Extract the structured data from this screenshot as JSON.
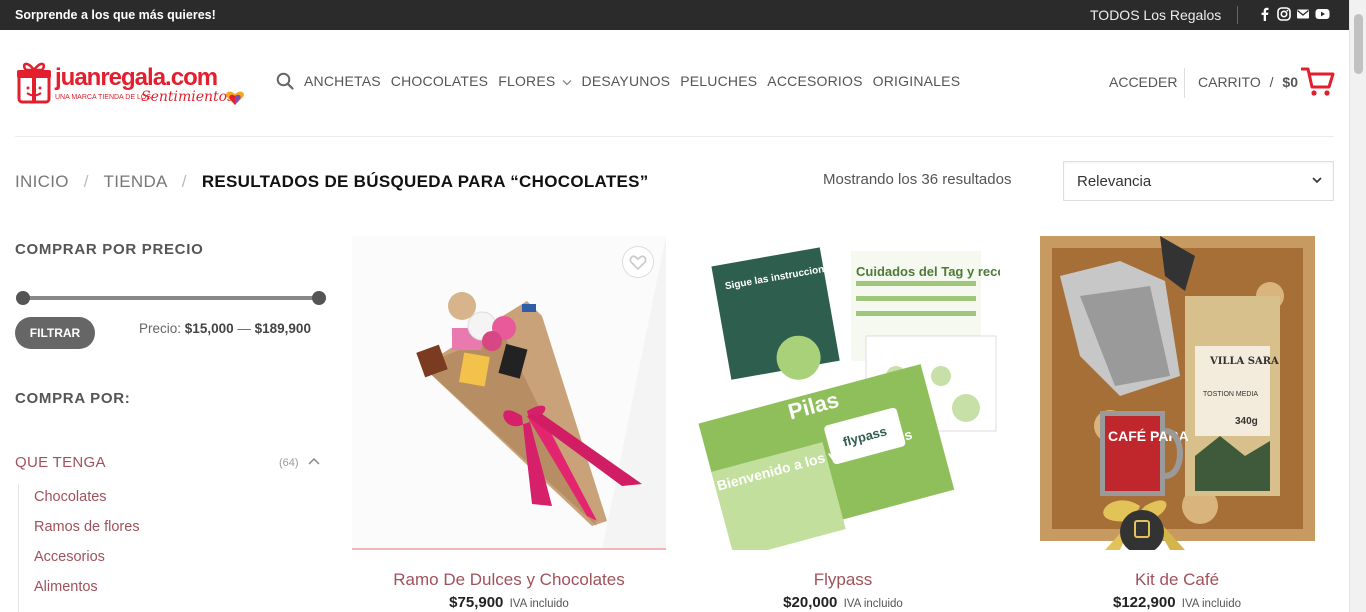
{
  "topbar": {
    "promo": "Sorprende a los que más quieres!",
    "todos": "TODOS Los Regalos",
    "social": [
      "facebook-icon",
      "instagram-icon",
      "email-icon",
      "youtube-icon"
    ]
  },
  "brand": {
    "logo_text": "juanregala.com",
    "tagline": "UNA MARCA TIENDA DE LOS",
    "tagline_script": "Sentimientos",
    "accent": "#e31f2d"
  },
  "nav": {
    "items": [
      "ANCHETAS",
      "CHOCOLATES",
      "FLORES",
      "DESAYUNOS",
      "PELUCHES",
      "ACCESORIOS",
      "ORIGINALES"
    ],
    "acceder": "ACCEDER",
    "carrito_label": "CARRITO",
    "carrito_sep": "/",
    "carrito_total": "$0"
  },
  "breadcrumb": {
    "inicio": "INICIO",
    "tienda": "TIENDA",
    "divider": "/",
    "current": "RESULTADOS DE BÚSQUEDA PARA “CHOCOLATES”"
  },
  "results_text": "Mostrando los 36 resultados",
  "sort": {
    "selected": "Relevancia"
  },
  "sidebar": {
    "price_title": "COMPRAR POR PRECIO",
    "filter_button": "FILTRAR",
    "price_label": "Precio:",
    "price_min": "$15,000",
    "price_dash": "—",
    "price_max": "$189,900",
    "compra_title": "COMPRA POR:",
    "category_head": "QUE TENGA",
    "category_count": "(64)",
    "categories": [
      "Chocolates",
      "Ramos de flores",
      "Accesorios",
      "Alimentos"
    ]
  },
  "products": [
    {
      "name": "Ramo De Dulces y Chocolates",
      "price": "$75,900",
      "tax": "IVA incluido"
    },
    {
      "name": "Flypass",
      "price": "$20,000",
      "tax": "IVA incluido"
    },
    {
      "name": "Kit de Café",
      "price": "$122,900",
      "tax": "IVA incluido"
    }
  ],
  "product_image_text": {
    "flypass_card1": "Sigue las instrucciones y ubica bien tu Tag",
    "flypass_card2": "Cuidados del Tag y recomendaciones",
    "flypass_card3": "Pilas",
    "flypass_card4": "Bienvenido a los viajes felices",
    "flypass_logo": "flypass",
    "coffee_brand": "VILLA SARA",
    "coffee_roast": "TOSTION MEDIA",
    "coffee_weight": "340g",
    "mug_text": "CAFÉ PARA"
  }
}
